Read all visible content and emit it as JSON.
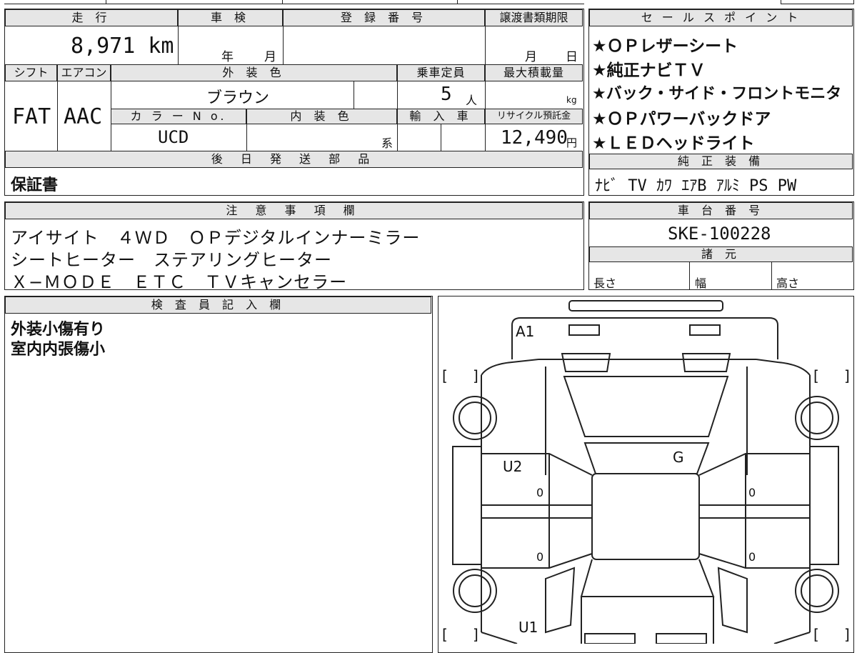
{
  "top": {
    "mileage_header": "走 行",
    "mileage_value": "8,971 km",
    "inspection_header": "車 検",
    "inspection_year": "年",
    "inspection_month": "月",
    "registration_header": "登 録 番 号",
    "transfer_header": "譲渡書類期限",
    "transfer_month": "月",
    "transfer_day": "日",
    "shift_header": "シフト",
    "aircon_header": "エアコン",
    "exterior_header": "外 装 色",
    "seating_header": "乗車定員",
    "max_load_header": "最大積載量",
    "shift_value": "FAT",
    "aircon_value": "AAC",
    "exterior_value": "ブラウン",
    "seating_value": "5",
    "seating_unit": "人",
    "max_load_unit": "kg",
    "color_no_header": "カ ラ ー N o.",
    "interior_header": "内 装 色",
    "import_header": "輸 入 車",
    "recycle_header": "リサイクル預託金",
    "color_no_value": "UCD",
    "interior_suffix": "系",
    "recycle_value": "12,490",
    "recycle_unit": "円",
    "later_parts_header": "後 日 発 送 部 品",
    "later_parts_value": "保証書"
  },
  "sales_points": {
    "header": "セ ー ル ス ポ イ ン ト",
    "items": [
      "★ＯＰレザーシート",
      "★純正ナビＴＶ",
      "★バック・サイド・フロントモニタ",
      "★ＯＰパワーバックドア",
      "★ＬＥＤヘッドライト"
    ]
  },
  "factory_equipment": {
    "header": "純 正 装 備",
    "value": "ﾅﾋﾞ TV ｶﾜ ｴｱB ｱﾙﾐ PS PW"
  },
  "notes": {
    "header": "注 意 事 項 欄",
    "lines": [
      "アイサイト　４ＷＤ　ＯＰデジタルインナーミラー",
      "シートヒーター　ステアリングヒーター",
      "Ｘ−ＭＯＤＥ　ＥＴＣ　ＴＶキャンセラー"
    ]
  },
  "chassis": {
    "header": "車 台 番 号",
    "value": "SKE-100228"
  },
  "specs": {
    "header": "諸 元",
    "length": "長さ",
    "width": "幅",
    "height": "高さ"
  },
  "inspector": {
    "header": "検 査 員 記 入 欄",
    "lines": [
      "外装小傷有り",
      "室内内張傷小"
    ]
  },
  "diagram": {
    "marks": {
      "a1": "A1",
      "u2": "U2",
      "g": "G",
      "u1": "U1"
    },
    "zeros": [
      "0",
      "0",
      "0",
      "0"
    ],
    "brackets": {
      "open": "[",
      "close": "]"
    }
  }
}
